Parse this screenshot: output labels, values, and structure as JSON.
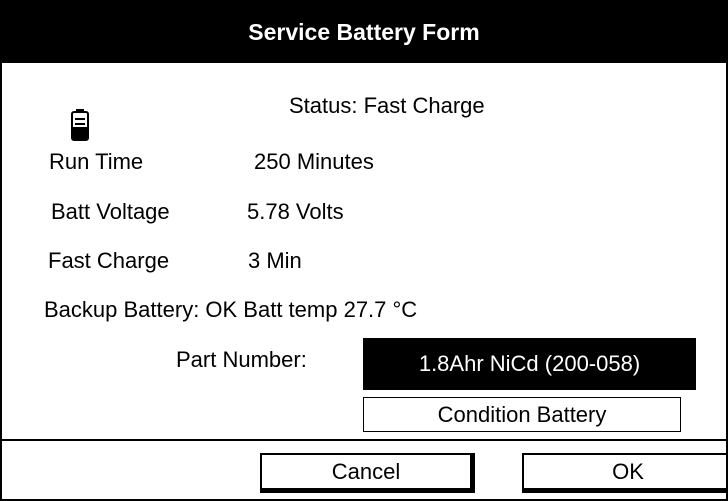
{
  "window": {
    "title": "Service Battery Form"
  },
  "status": {
    "text": "Status: Fast Charge",
    "icon": "battery-icon"
  },
  "fields": {
    "run_time_label": "Run Time",
    "run_time_value": "250 Minutes",
    "batt_voltage_label": "Batt Voltage",
    "batt_voltage_value": "5.78 Volts",
    "fast_charge_label": "Fast Charge",
    "fast_charge_value": "3 Min",
    "backup_line": "Backup Battery: OK Batt temp 27.7 °C"
  },
  "part": {
    "label": "Part Number:",
    "value": "1.8Ahr NiCd (200-058)"
  },
  "buttons": {
    "condition": "Condition Battery",
    "cancel": "Cancel",
    "ok": "OK"
  }
}
